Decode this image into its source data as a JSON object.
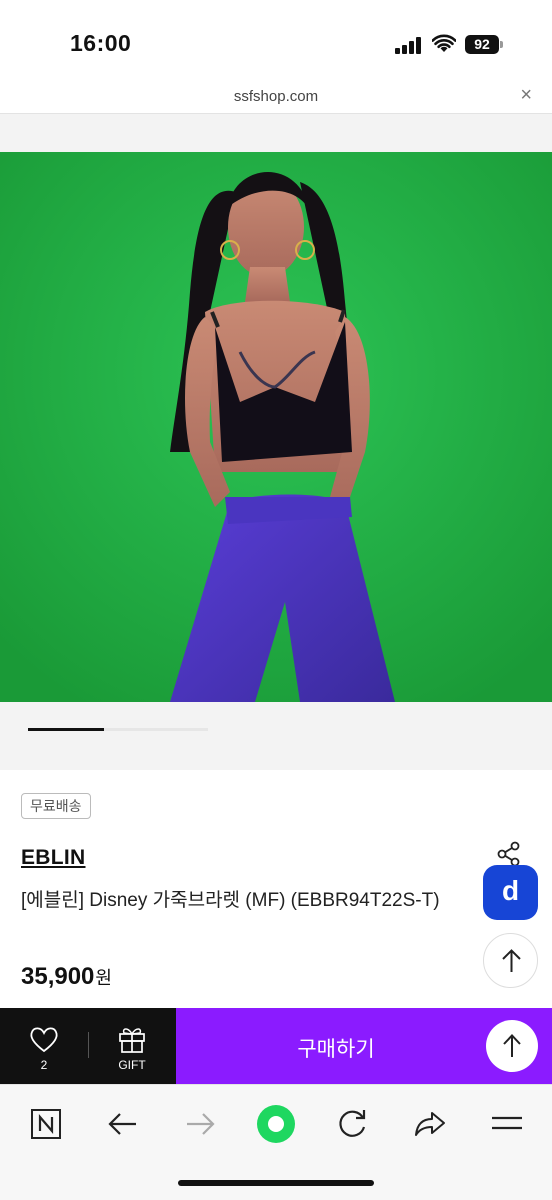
{
  "status_bar": {
    "time": "16:00",
    "battery": "92"
  },
  "browser": {
    "url": "ssfshop.com",
    "close_glyph": "×"
  },
  "gallery": {
    "current_slide": 1,
    "total_slides": 3
  },
  "product": {
    "badge": "무료배송",
    "brand": "EBLIN",
    "title": "[에블린] Disney 가죽브라렛 (MF) (EBBR94T22S-T)",
    "price": "35,900",
    "price_unit": "원"
  },
  "floating": {
    "d_label": "d"
  },
  "purchase_bar": {
    "like_count": "2",
    "gift_label": "GIFT",
    "buy_label": "구매하기"
  },
  "toolbar": {
    "items": [
      "n-icon",
      "back-icon",
      "forward-icon",
      "home-icon",
      "reload-icon",
      "share-icon",
      "menu-icon"
    ]
  },
  "colors": {
    "accent": "#8b1bff",
    "d_badge": "#1745d6",
    "hero_bg": "#21b545",
    "home_button": "#1ed760"
  }
}
